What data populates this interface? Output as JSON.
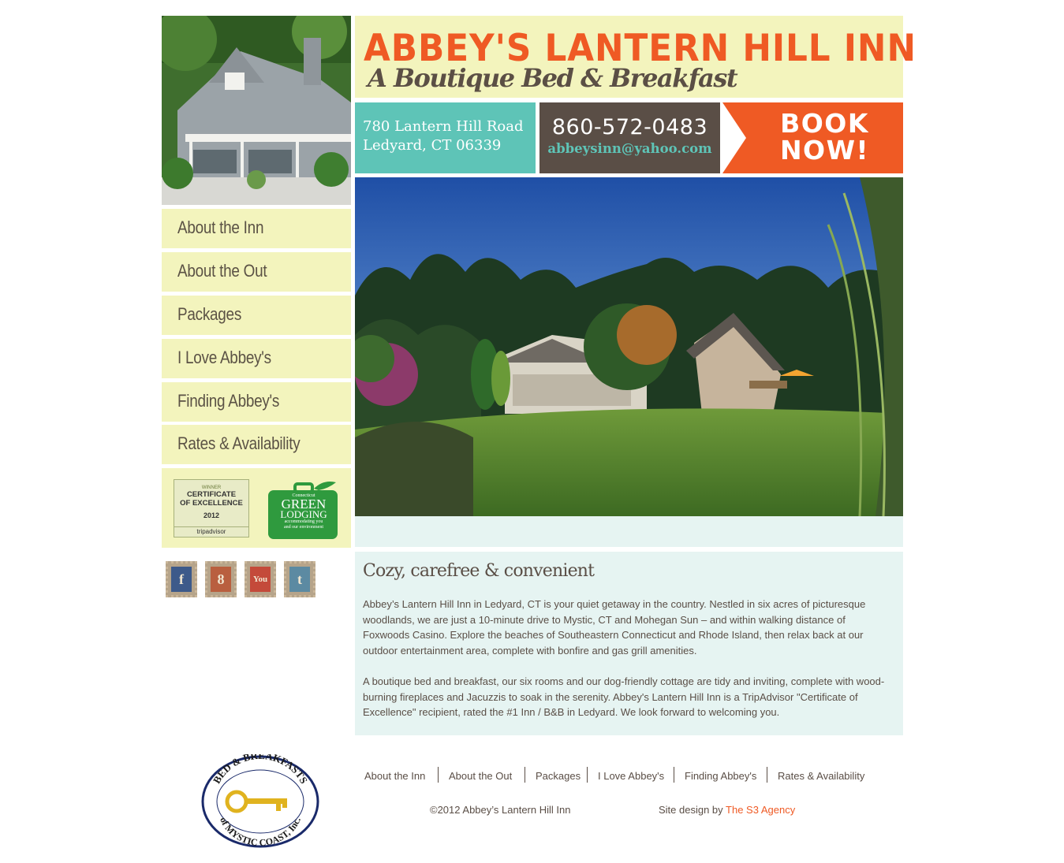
{
  "header": {
    "title": "ABBEY'S LANTERN HILL INN",
    "tagline": "A Boutique Bed & Breakfast",
    "address_line1": "780 Lantern Hill Road",
    "address_line2": "Ledyard, CT 06339",
    "phone": "860-572-0483",
    "email": "abbeysinn@yahoo.com",
    "book_line1": "BOOK",
    "book_line2": "NOW!"
  },
  "sidebar": {
    "nav": [
      {
        "label": "About the Inn"
      },
      {
        "label": "About the Out"
      },
      {
        "label": "Packages"
      },
      {
        "label": "I Love Abbey's"
      },
      {
        "label": "Finding Abbey's"
      },
      {
        "label": "Rates & Availability"
      }
    ],
    "badges": {
      "tripadvisor": {
        "winner": "WINNER",
        "line1": "CERTIFICATE",
        "line2": "OF EXCELLENCE",
        "year": "2012",
        "brand": "tripadvisor"
      },
      "green": {
        "top": "Connecticut",
        "line1": "GREEN",
        "line2": "LODGING",
        "sub1": "accommodating you",
        "sub2": "and our environment"
      }
    },
    "social": [
      {
        "name": "facebook-icon",
        "glyph": "f"
      },
      {
        "name": "google-plus-icon",
        "glyph": "8"
      },
      {
        "name": "youtube-icon",
        "glyph": "You"
      },
      {
        "name": "twitter-icon",
        "glyph": "t"
      }
    ]
  },
  "content": {
    "heading": "Cozy, carefree & convenient",
    "paragraph1": "Abbey’s Lantern Hill Inn in Ledyard, CT is your quiet getaway in the country. Nestled in six acres of picturesque woodlands, we are just a 10-minute drive to Mystic, CT and Mohegan Sun – and within walking distance of Foxwoods Casino. Explore the beaches of Southeastern Connecticut and Rhode Island, then relax back at our outdoor entertainment area, complete with bonfire and gas grill amenities.",
    "paragraph2": "A boutique bed and breakfast, our six rooms and our dog-friendly cottage are tidy and inviting, complete with wood-burning fireplaces and Jacuzzis to soak in the serenity. Abbey's Lantern Hill Inn is a TripAdvisor \"Certificate of Excellence\" recipient, rated the #1 Inn / B&B in Ledyard. We look forward to welcoming you."
  },
  "footer": {
    "seal_top": "BED & BREAKFASTS",
    "seal_bottom": "of MYSTIC COAST, Inc.",
    "nav": [
      {
        "label": "About the Inn"
      },
      {
        "label": "About the Out"
      },
      {
        "label": "Packages"
      },
      {
        "label": "I Love Abbey's"
      },
      {
        "label": "Finding Abbey's"
      },
      {
        "label": "Rates & Availability"
      }
    ],
    "copyright": "©2012 Abbey’s Lantern Hill Inn",
    "credit_prefix": "Site design by ",
    "credit_link": "The S3 Agency"
  },
  "colors": {
    "accent_orange": "#ef5a24",
    "teal": "#5ec4b7",
    "brown": "#5a4e46",
    "cream": "#f3f4bd",
    "pale_teal": "#e6f4f2"
  }
}
